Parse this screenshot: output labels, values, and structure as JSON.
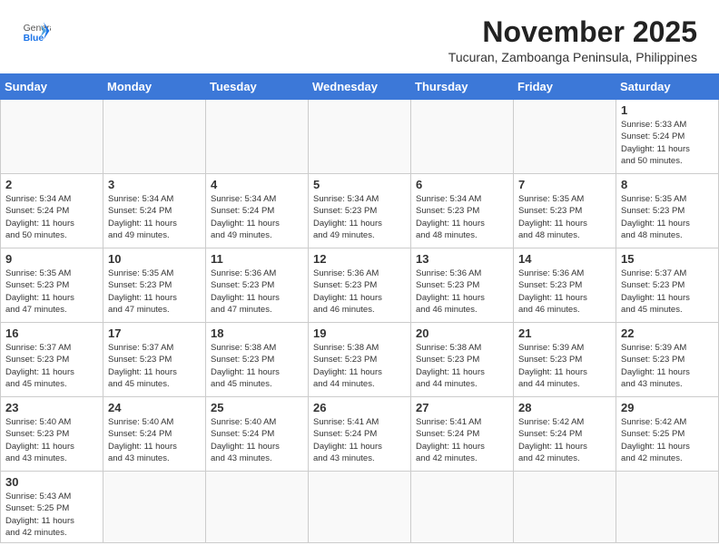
{
  "header": {
    "logo_general": "General",
    "logo_blue": "Blue",
    "month_title": "November 2025",
    "subtitle": "Tucuran, Zamboanga Peninsula, Philippines"
  },
  "weekdays": [
    "Sunday",
    "Monday",
    "Tuesday",
    "Wednesday",
    "Thursday",
    "Friday",
    "Saturday"
  ],
  "weeks": [
    [
      {
        "day": "",
        "info": ""
      },
      {
        "day": "",
        "info": ""
      },
      {
        "day": "",
        "info": ""
      },
      {
        "day": "",
        "info": ""
      },
      {
        "day": "",
        "info": ""
      },
      {
        "day": "",
        "info": ""
      },
      {
        "day": "1",
        "info": "Sunrise: 5:33 AM\nSunset: 5:24 PM\nDaylight: 11 hours\nand 50 minutes."
      }
    ],
    [
      {
        "day": "2",
        "info": "Sunrise: 5:34 AM\nSunset: 5:24 PM\nDaylight: 11 hours\nand 50 minutes."
      },
      {
        "day": "3",
        "info": "Sunrise: 5:34 AM\nSunset: 5:24 PM\nDaylight: 11 hours\nand 49 minutes."
      },
      {
        "day": "4",
        "info": "Sunrise: 5:34 AM\nSunset: 5:24 PM\nDaylight: 11 hours\nand 49 minutes."
      },
      {
        "day": "5",
        "info": "Sunrise: 5:34 AM\nSunset: 5:23 PM\nDaylight: 11 hours\nand 49 minutes."
      },
      {
        "day": "6",
        "info": "Sunrise: 5:34 AM\nSunset: 5:23 PM\nDaylight: 11 hours\nand 48 minutes."
      },
      {
        "day": "7",
        "info": "Sunrise: 5:35 AM\nSunset: 5:23 PM\nDaylight: 11 hours\nand 48 minutes."
      },
      {
        "day": "8",
        "info": "Sunrise: 5:35 AM\nSunset: 5:23 PM\nDaylight: 11 hours\nand 48 minutes."
      }
    ],
    [
      {
        "day": "9",
        "info": "Sunrise: 5:35 AM\nSunset: 5:23 PM\nDaylight: 11 hours\nand 47 minutes."
      },
      {
        "day": "10",
        "info": "Sunrise: 5:35 AM\nSunset: 5:23 PM\nDaylight: 11 hours\nand 47 minutes."
      },
      {
        "day": "11",
        "info": "Sunrise: 5:36 AM\nSunset: 5:23 PM\nDaylight: 11 hours\nand 47 minutes."
      },
      {
        "day": "12",
        "info": "Sunrise: 5:36 AM\nSunset: 5:23 PM\nDaylight: 11 hours\nand 46 minutes."
      },
      {
        "day": "13",
        "info": "Sunrise: 5:36 AM\nSunset: 5:23 PM\nDaylight: 11 hours\nand 46 minutes."
      },
      {
        "day": "14",
        "info": "Sunrise: 5:36 AM\nSunset: 5:23 PM\nDaylight: 11 hours\nand 46 minutes."
      },
      {
        "day": "15",
        "info": "Sunrise: 5:37 AM\nSunset: 5:23 PM\nDaylight: 11 hours\nand 45 minutes."
      }
    ],
    [
      {
        "day": "16",
        "info": "Sunrise: 5:37 AM\nSunset: 5:23 PM\nDaylight: 11 hours\nand 45 minutes."
      },
      {
        "day": "17",
        "info": "Sunrise: 5:37 AM\nSunset: 5:23 PM\nDaylight: 11 hours\nand 45 minutes."
      },
      {
        "day": "18",
        "info": "Sunrise: 5:38 AM\nSunset: 5:23 PM\nDaylight: 11 hours\nand 45 minutes."
      },
      {
        "day": "19",
        "info": "Sunrise: 5:38 AM\nSunset: 5:23 PM\nDaylight: 11 hours\nand 44 minutes."
      },
      {
        "day": "20",
        "info": "Sunrise: 5:38 AM\nSunset: 5:23 PM\nDaylight: 11 hours\nand 44 minutes."
      },
      {
        "day": "21",
        "info": "Sunrise: 5:39 AM\nSunset: 5:23 PM\nDaylight: 11 hours\nand 44 minutes."
      },
      {
        "day": "22",
        "info": "Sunrise: 5:39 AM\nSunset: 5:23 PM\nDaylight: 11 hours\nand 43 minutes."
      }
    ],
    [
      {
        "day": "23",
        "info": "Sunrise: 5:40 AM\nSunset: 5:23 PM\nDaylight: 11 hours\nand 43 minutes."
      },
      {
        "day": "24",
        "info": "Sunrise: 5:40 AM\nSunset: 5:24 PM\nDaylight: 11 hours\nand 43 minutes."
      },
      {
        "day": "25",
        "info": "Sunrise: 5:40 AM\nSunset: 5:24 PM\nDaylight: 11 hours\nand 43 minutes."
      },
      {
        "day": "26",
        "info": "Sunrise: 5:41 AM\nSunset: 5:24 PM\nDaylight: 11 hours\nand 43 minutes."
      },
      {
        "day": "27",
        "info": "Sunrise: 5:41 AM\nSunset: 5:24 PM\nDaylight: 11 hours\nand 42 minutes."
      },
      {
        "day": "28",
        "info": "Sunrise: 5:42 AM\nSunset: 5:24 PM\nDaylight: 11 hours\nand 42 minutes."
      },
      {
        "day": "29",
        "info": "Sunrise: 5:42 AM\nSunset: 5:25 PM\nDaylight: 11 hours\nand 42 minutes."
      }
    ],
    [
      {
        "day": "30",
        "info": "Sunrise: 5:43 AM\nSunset: 5:25 PM\nDaylight: 11 hours\nand 42 minutes."
      },
      {
        "day": "",
        "info": ""
      },
      {
        "day": "",
        "info": ""
      },
      {
        "day": "",
        "info": ""
      },
      {
        "day": "",
        "info": ""
      },
      {
        "day": "",
        "info": ""
      },
      {
        "day": "",
        "info": ""
      }
    ]
  ]
}
